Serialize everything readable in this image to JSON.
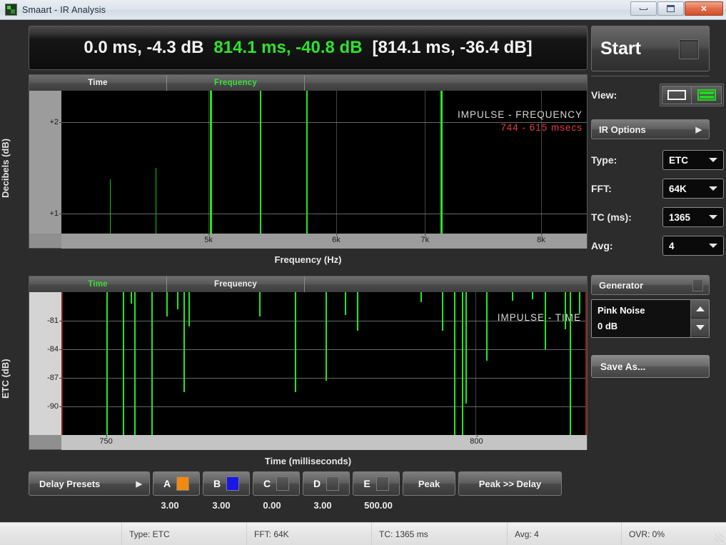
{
  "window": {
    "title": "Smaart - IR Analysis",
    "icon": "app-icon",
    "minimize_label": "",
    "maximize_label": "",
    "close_label": "✕"
  },
  "readout": {
    "cursor": "0.0 ms, -4.3 dB",
    "marker": "814.1 ms, -40.8 dB",
    "bracket": "[814.1 ms, -36.4 dB]",
    "green": "#2de32d"
  },
  "top_graph": {
    "tabs": [
      {
        "label": "Time",
        "active": false
      },
      {
        "label": "Frequency",
        "active": true
      }
    ],
    "overlay_title": "IMPULSE - FREQUENCY",
    "overlay_sub": "744 - 615 msecs",
    "x_title": "Frequency (Hz)",
    "y_title": "Decibels (dB)"
  },
  "bottom_graph": {
    "tabs": [
      {
        "label": "Time",
        "active": true
      },
      {
        "label": "Frequency",
        "active": false
      }
    ],
    "overlay_title": "IMPULSE - TIME",
    "x_title": "Time (milliseconds)",
    "y_title": "ETC (dB)"
  },
  "sidebar": {
    "start_label": "Start",
    "view_label": "View:",
    "view_single_icon": "single-pane-icon",
    "view_dual_icon": "dual-pane-icon",
    "view_selected": "dual",
    "ir_options_label": "IR Options",
    "ir_options_arrow": "▶",
    "fields": [
      {
        "label": "Type:",
        "value": "ETC"
      },
      {
        "label": "FFT:",
        "value": "64K"
      },
      {
        "label": "TC (ms):",
        "value": "1365"
      },
      {
        "label": "Avg:",
        "value": "4"
      }
    ],
    "generator_label": "Generator",
    "generator_signal": "Pink Noise",
    "generator_level": "0 dB",
    "save_as_label": "Save As..."
  },
  "bottom_toolbar": {
    "delay_presets_label": "Delay Presets",
    "delay_presets_arrow": "▶",
    "presets": [
      {
        "letter": "A",
        "color": "#f08a10",
        "value": "3.00"
      },
      {
        "letter": "B",
        "color": "#1a16e8",
        "value": "3.00"
      },
      {
        "letter": "C",
        "color": "",
        "value": "0.00"
      },
      {
        "letter": "D",
        "color": "",
        "value": "3.00"
      },
      {
        "letter": "E",
        "color": "",
        "value": "500.00"
      }
    ],
    "peak_label": "Peak",
    "peak_to_delay_label": "Peak >> Delay"
  },
  "statusbar": {
    "cells": [
      "Type: ETC",
      "FFT: 64K",
      "TC: 1365 ms",
      "Avg: 4",
      "OVR: 0%"
    ],
    "grip_icon": "resize-grip-icon"
  },
  "chart_data": [
    {
      "type": "bar",
      "name": "impulse-frequency",
      "title": "IMPULSE - FREQUENCY",
      "annotation": "744 - 615 msecs",
      "xlabel": "Frequency (Hz)",
      "ylabel": "Decibels (dB)",
      "xtick_labels": [
        "5k",
        "6k",
        "7k",
        "8k"
      ],
      "xtick_positions_pct": [
        28.0,
        52.3,
        69.2,
        91.3
      ],
      "ytick_labels": [
        "+2",
        "+1"
      ],
      "ytick_positions_pct": [
        22.0,
        86.0
      ],
      "grid": true,
      "series_color": "#21e821",
      "points": [
        {
          "x_pct": 9.2,
          "height_pct": 38
        },
        {
          "x_pct": 18.0,
          "height_pct": 46
        },
        {
          "x_pct": 28.2,
          "height_pct": 100,
          "width": 3
        },
        {
          "x_pct": 37.8,
          "height_pct": 100
        },
        {
          "x_pct": 46.6,
          "height_pct": 100
        },
        {
          "x_pct": 72.2,
          "height_pct": 100,
          "width": 3
        }
      ]
    },
    {
      "type": "bar",
      "name": "impulse-time-etc",
      "title": "IMPULSE - TIME",
      "xlabel": "Time (milliseconds)",
      "ylabel": "ETC (dB)",
      "xtick_labels": [
        "750",
        "800"
      ],
      "xtick_positions_pct": [
        8.5,
        79.0
      ],
      "ytick_labels": [
        "-81",
        "-84",
        "-87",
        "-90"
      ],
      "ytick_positions_pct": [
        20.0,
        40.0,
        60.0,
        80.0
      ],
      "grid": true,
      "series_color": "#21e821",
      "orientation": "down-from-top",
      "points": [
        {
          "x_pct": 8.4,
          "depth_pct": 100
        },
        {
          "x_pct": 11.5,
          "depth_pct": 100
        },
        {
          "x_pct": 13.0,
          "depth_pct": 8
        },
        {
          "x_pct": 13.6,
          "depth_pct": 100
        },
        {
          "x_pct": 17.0,
          "depth_pct": 100
        },
        {
          "x_pct": 19.8,
          "depth_pct": 17
        },
        {
          "x_pct": 21.8,
          "depth_pct": 12
        },
        {
          "x_pct": 23.1,
          "depth_pct": 70
        },
        {
          "x_pct": 24.0,
          "depth_pct": 24
        },
        {
          "x_pct": 37.5,
          "depth_pct": 17
        },
        {
          "x_pct": 44.4,
          "depth_pct": 70
        },
        {
          "x_pct": 50.3,
          "depth_pct": 62
        },
        {
          "x_pct": 54.0,
          "depth_pct": 16
        },
        {
          "x_pct": 56.3,
          "depth_pct": 27
        },
        {
          "x_pct": 68.5,
          "depth_pct": 7
        },
        {
          "x_pct": 72.5,
          "depth_pct": 27
        },
        {
          "x_pct": 74.8,
          "depth_pct": 100
        },
        {
          "x_pct": 76.4,
          "depth_pct": 100
        },
        {
          "x_pct": 77.0,
          "depth_pct": 78
        },
        {
          "x_pct": 81.0,
          "depth_pct": 48
        },
        {
          "x_pct": 85.9,
          "depth_pct": 6
        },
        {
          "x_pct": 89.8,
          "depth_pct": 5
        },
        {
          "x_pct": 92.2,
          "depth_pct": 40
        },
        {
          "x_pct": 96.0,
          "depth_pct": 26
        },
        {
          "x_pct": 97.0,
          "depth_pct": 100
        },
        {
          "x_pct": 98.8,
          "depth_pct": 15
        }
      ]
    }
  ]
}
